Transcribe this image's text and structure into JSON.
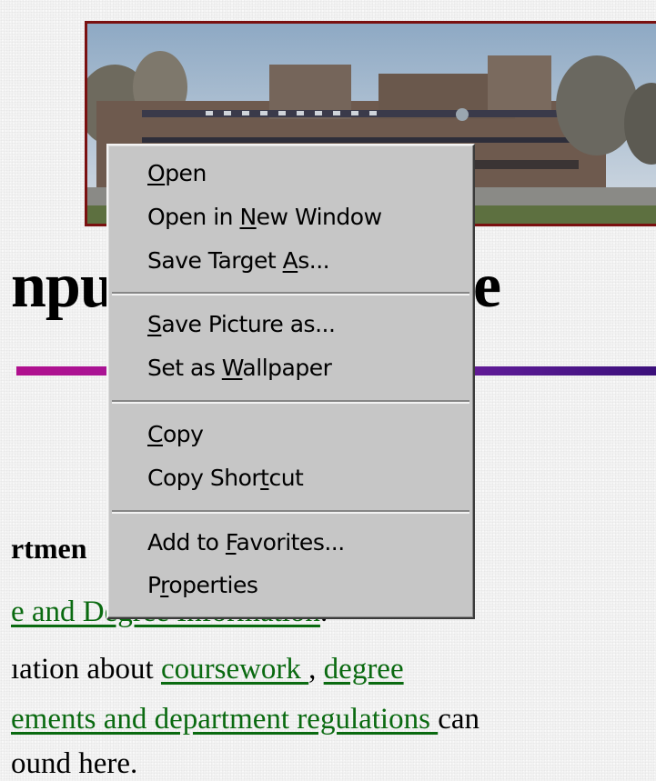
{
  "page": {
    "heading_left": "npu",
    "heading_right": "e",
    "dept_label": "rtmen",
    "line1_link": "e and Degree Information",
    "line1_tail": ".",
    "line2_prefix": "ıation about ",
    "line2_link1": "coursework ",
    "line2_sep": ", ",
    "line2_link2": "degree ",
    "line3_link": "ements and department regulations ",
    "line3_tail": "can",
    "line4_text": "ound here."
  },
  "context_menu": {
    "items": [
      {
        "pre": "",
        "key": "O",
        "post": "pen"
      },
      {
        "pre": "Open in ",
        "key": "N",
        "post": "ew Window"
      },
      {
        "pre": "Save Target ",
        "key": "A",
        "post": "s..."
      },
      {
        "pre": "",
        "key": "S",
        "post": "ave Picture as..."
      },
      {
        "pre": "Set as ",
        "key": "W",
        "post": "allpaper"
      },
      {
        "pre": "",
        "key": "C",
        "post": "opy"
      },
      {
        "pre": "Copy Shor",
        "key": "t",
        "post": "cut"
      },
      {
        "pre": "Add to ",
        "key": "F",
        "post": "avorites..."
      },
      {
        "pre": "P",
        "key": "r",
        "post": "operties"
      }
    ]
  },
  "colors": {
    "link": "#0a6a10",
    "frame": "#7a1010",
    "menu_bg": "#c6c6c6",
    "rule_start": "#b0108e",
    "rule_end": "#3a107a"
  }
}
